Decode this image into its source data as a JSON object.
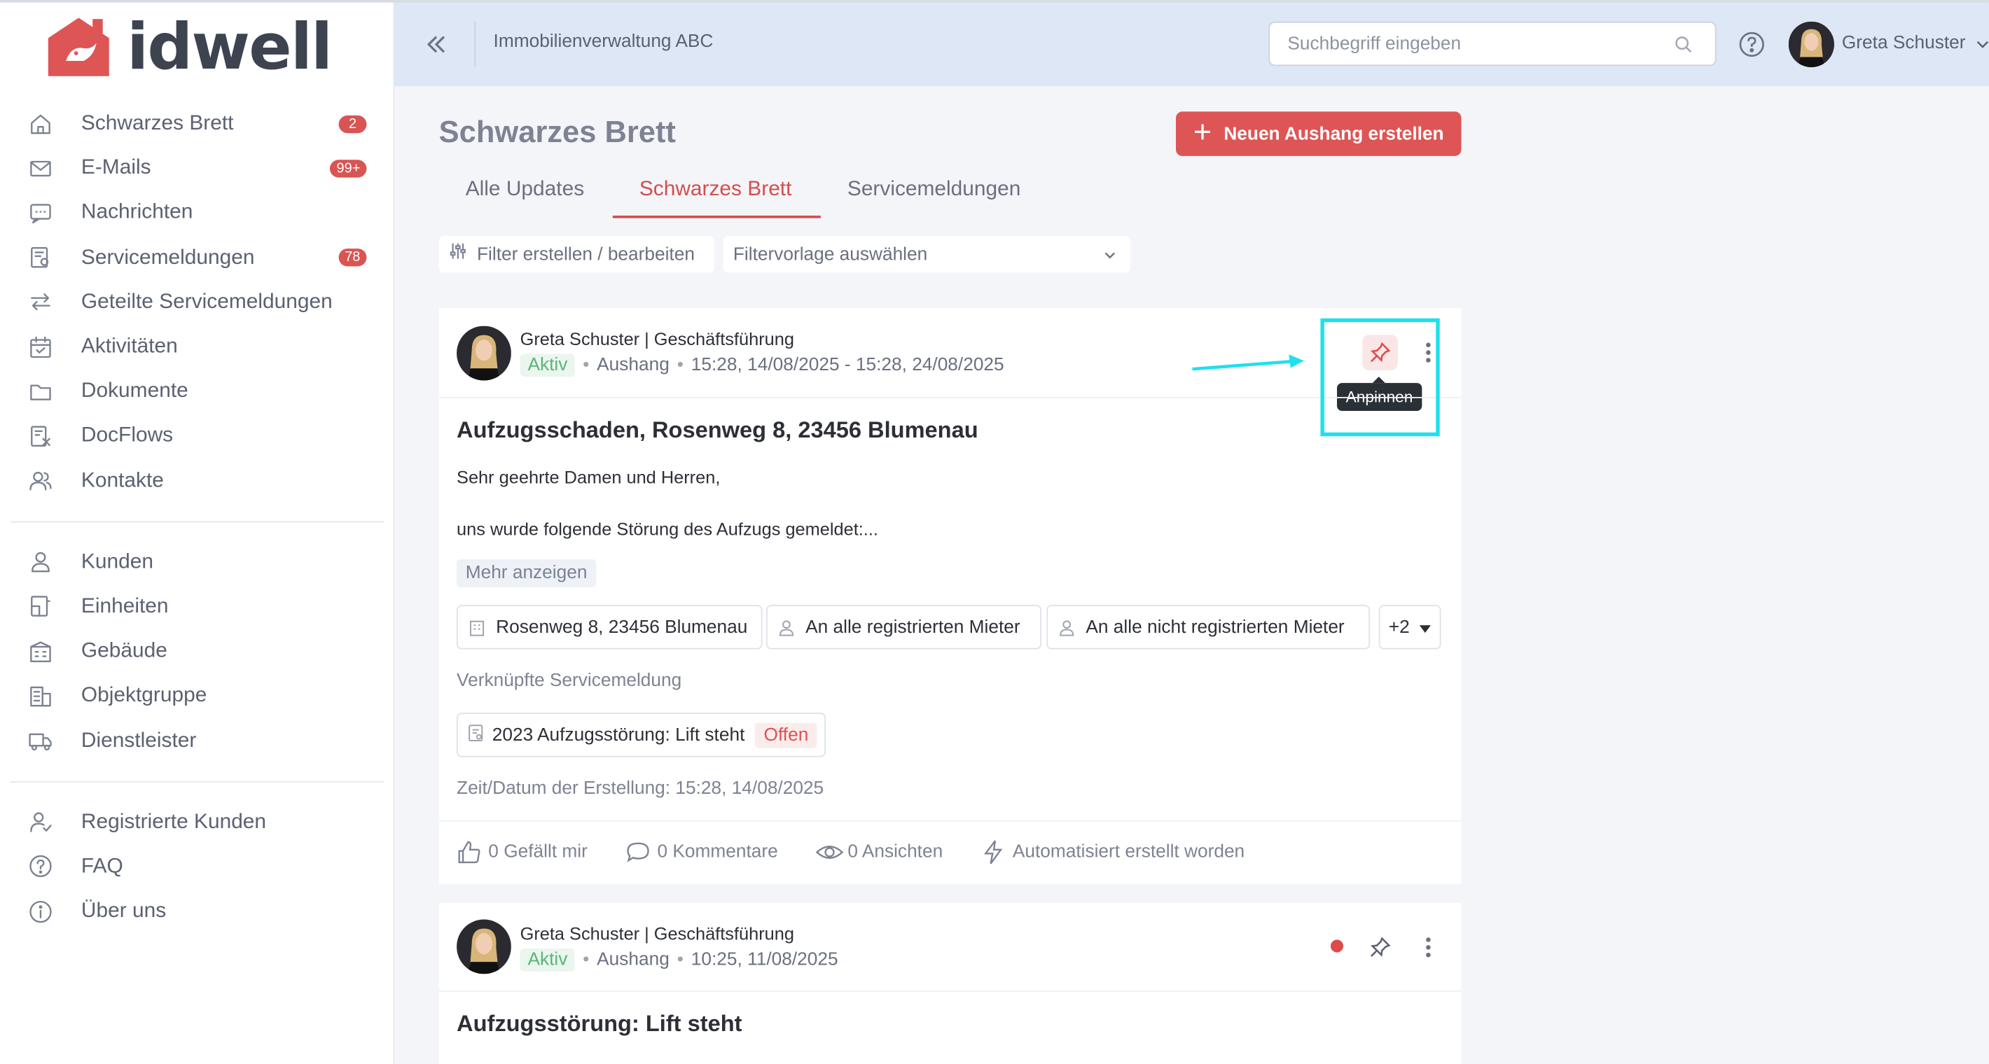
{
  "app": {
    "logo_text": "idwell",
    "company": "Immobilienverwaltung ABC"
  },
  "colors": {
    "accent": "#de5555",
    "header_bg": "#dde7f6",
    "active_status": "#5cb57a",
    "highlight": "#1fe0ee"
  },
  "sidebar": {
    "groups": [
      [
        {
          "label": "Schwarzes Brett",
          "icon": "home-icon",
          "badge": "2"
        },
        {
          "label": "E-Mails",
          "icon": "mail-icon",
          "badge": "99+"
        },
        {
          "label": "Nachrichten",
          "icon": "chat-icon",
          "badge": null
        },
        {
          "label": "Servicemeldungen",
          "icon": "service-icon",
          "badge": "78"
        },
        {
          "label": "Geteilte Servicemeldungen",
          "icon": "share-arrows-icon",
          "badge": null
        },
        {
          "label": "Aktivitäten",
          "icon": "calendar-icon",
          "badge": null
        },
        {
          "label": "Dokumente",
          "icon": "folder-icon",
          "badge": null
        },
        {
          "label": "DocFlows",
          "icon": "docflow-icon",
          "badge": null
        },
        {
          "label": "Kontakte",
          "icon": "contacts-icon",
          "badge": null
        }
      ],
      [
        {
          "label": "Kunden",
          "icon": "user-icon",
          "badge": null
        },
        {
          "label": "Einheiten",
          "icon": "unit-icon",
          "badge": null
        },
        {
          "label": "Gebäude",
          "icon": "building-icon",
          "badge": null
        },
        {
          "label": "Objektgruppe",
          "icon": "object-group-icon",
          "badge": null
        },
        {
          "label": "Dienstleister",
          "icon": "truck-icon",
          "badge": null
        }
      ],
      [
        {
          "label": "Registrierte Kunden",
          "icon": "registered-user-icon",
          "badge": null
        },
        {
          "label": "FAQ",
          "icon": "question-icon",
          "badge": null
        },
        {
          "label": "Über uns",
          "icon": "info-icon",
          "badge": null
        }
      ]
    ]
  },
  "header": {
    "search_placeholder": "Suchbegriff eingeben",
    "user_name": "Greta Schuster"
  },
  "main": {
    "title": "Schwarzes Brett",
    "new_button": "Neuen Aushang erstellen",
    "tabs": [
      {
        "label": "Alle Updates",
        "active": false
      },
      {
        "label": "Schwarzes Brett",
        "active": true
      },
      {
        "label": "Servicemeldungen",
        "active": false
      }
    ],
    "filter_button": "Filter erstellen / bearbeiten",
    "filter_select": "Filtervorlage auswählen"
  },
  "posts": [
    {
      "author": "Greta Schuster | Geschäftsführung",
      "status": "Aktiv",
      "type": "Aushang",
      "time": "15:28, 14/08/2025 - 15:28, 24/08/2025",
      "title": "Aufzugsschaden, Rosenweg 8, 23456 Blumenau",
      "body_line1": "Sehr geehrte Damen und Herren,",
      "body_line2": "uns wurde folgende Störung des Aufzugs gemeldet:...",
      "more": "Mehr anzeigen",
      "chips": [
        "Rosenweg 8, 23456 Blumenau",
        "An alle registrierten Mieter",
        "An alle nicht registrierten Mieter"
      ],
      "chips_more": "+2",
      "linked_label": "Verknüpfte Servicemeldung",
      "linked_ticket": "2023 Aufzugsstörung: Lift steht",
      "linked_status": "Offen",
      "created": "Zeit/Datum der Erstellung: 15:28, 14/08/2025",
      "likes": "0 Gefällt mir",
      "comments": "0 Kommentare",
      "views": "0 Ansichten",
      "automated": "Automatisiert erstellt worden",
      "pin_tooltip": "Anpinnen"
    },
    {
      "author": "Greta Schuster | Geschäftsführung",
      "status": "Aktiv",
      "type": "Aushang",
      "time": "10:25, 11/08/2025",
      "title": "Aufzugsstörung: Lift steht"
    }
  ]
}
